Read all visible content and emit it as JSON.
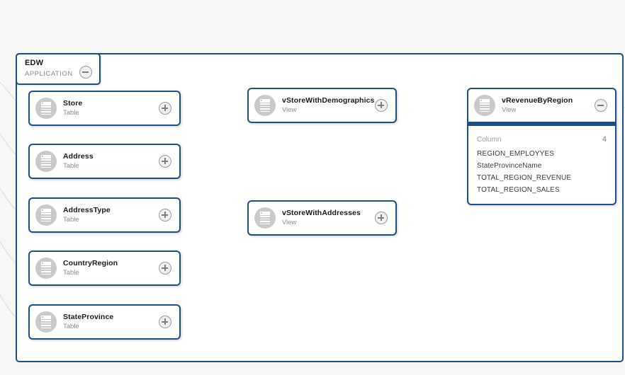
{
  "canvas": {
    "background": "#f7f7f7",
    "accent_border": "#1b4f87",
    "edge_color": "#d8d8d8"
  },
  "application": {
    "title": "EDW",
    "subtitle": "APPLICATION",
    "toggle_icon": "minus-circle-icon",
    "toggle_state": "expanded"
  },
  "nodes": [
    {
      "id": "store",
      "name": "Store",
      "type": "Table",
      "icon": "table-icon",
      "toggle_icon": "plus-circle-icon",
      "expanded": false
    },
    {
      "id": "address",
      "name": "Address",
      "type": "Table",
      "icon": "table-icon",
      "toggle_icon": "plus-circle-icon",
      "expanded": false
    },
    {
      "id": "address-type",
      "name": "AddressType",
      "type": "Table",
      "icon": "table-icon",
      "toggle_icon": "plus-circle-icon",
      "expanded": false
    },
    {
      "id": "country-region",
      "name": "CountryRegion",
      "type": "Table",
      "icon": "table-icon",
      "toggle_icon": "plus-circle-icon",
      "expanded": false
    },
    {
      "id": "state-province",
      "name": "StateProvince",
      "type": "Table",
      "icon": "table-icon",
      "toggle_icon": "plus-circle-icon",
      "expanded": false
    },
    {
      "id": "v-store-with-demographics",
      "name": "vStoreWithDemographics",
      "type": "View",
      "icon": "view-icon",
      "toggle_icon": "plus-circle-icon",
      "expanded": false
    },
    {
      "id": "v-store-with-addresses",
      "name": "vStoreWithAddresses",
      "type": "View",
      "icon": "view-icon",
      "toggle_icon": "plus-circle-icon",
      "expanded": false
    },
    {
      "id": "v-revenue-by-region",
      "name": "vRevenueByRegion",
      "type": "View",
      "icon": "view-icon",
      "toggle_icon": "minus-circle-icon",
      "expanded": true
    }
  ],
  "detail_panel": {
    "owner": "vRevenueByRegion",
    "header_label": "Column",
    "count": "4",
    "columns": [
      "REGION_EMPLOYYES",
      "StateProvinceName",
      "TOTAL_REGION_REVENUE",
      "TOTAL_REGION_SALES"
    ]
  }
}
